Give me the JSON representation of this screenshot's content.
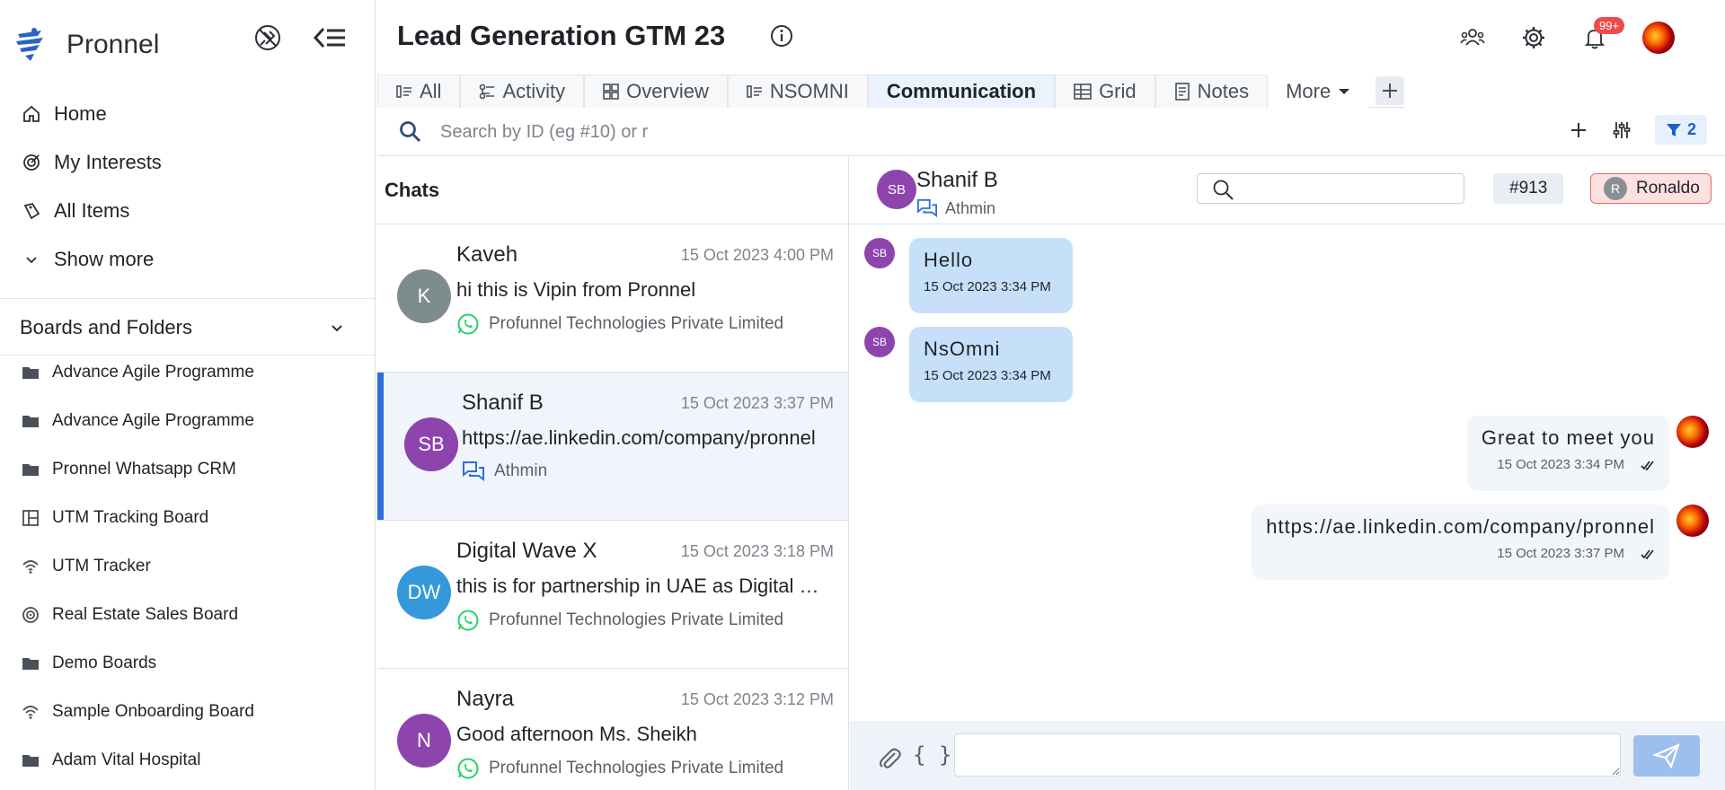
{
  "brand": {
    "name": "Pronnel"
  },
  "sidebar": {
    "nav": [
      {
        "label": "Home",
        "icon": "home-icon"
      },
      {
        "label": "My Interests",
        "icon": "target-icon"
      },
      {
        "label": "All Items",
        "icon": "tag-icon"
      },
      {
        "label": "Show more",
        "icon": "chevron-down-icon"
      }
    ],
    "boards_title": "Boards and Folders",
    "folders": [
      {
        "label": "Advance Agile Programme",
        "icon": "folder-icon"
      },
      {
        "label": "Advance Agile Programme",
        "icon": "folder-icon"
      },
      {
        "label": "Pronnel Whatsapp CRM",
        "icon": "folder-icon"
      },
      {
        "label": "UTM Tracking Board",
        "icon": "board-icon"
      },
      {
        "label": "UTM Tracker",
        "icon": "wifi-icon"
      },
      {
        "label": "Real Estate Sales Board",
        "icon": "target-icon"
      },
      {
        "label": "Demo Boards",
        "icon": "folder-icon"
      },
      {
        "label": "Sample Onboarding Board",
        "icon": "wifi-icon"
      },
      {
        "label": "Adam Vital Hospital",
        "icon": "folder-icon"
      }
    ]
  },
  "header": {
    "title": "Lead Generation GTM 23",
    "notification_count": "99+"
  },
  "tabs": [
    {
      "label": "All",
      "icon": "list-icon"
    },
    {
      "label": "Activity",
      "icon": "activity-icon"
    },
    {
      "label": "Overview",
      "icon": "grid-icon"
    },
    {
      "label": "NSOMNI",
      "icon": "list-icon"
    },
    {
      "label": "Communication",
      "icon": "",
      "active": true
    },
    {
      "label": "Grid",
      "icon": "table-icon"
    },
    {
      "label": "Notes",
      "icon": "notes-icon"
    },
    {
      "label": "More",
      "icon": "caret-down-icon"
    }
  ],
  "search": {
    "placeholder": "Search by ID (eg #10) or r",
    "value": ""
  },
  "filter": {
    "count": "2"
  },
  "chats": {
    "title": "Chats",
    "items": [
      {
        "initials": "K",
        "name": "Kaveh",
        "time": "15 Oct 2023 4:00 PM",
        "preview": "hi this is Vipin from Pronnel",
        "source": "Profunnel Technologies Private Limited",
        "channel": "whatsapp",
        "color": "#7f8c8d"
      },
      {
        "initials": "SB",
        "name": "Shanif B",
        "time": "15 Oct 2023 3:37 PM",
        "preview": "https://ae.linkedin.com/company/pronnel",
        "source": "Athmin",
        "channel": "chat",
        "color": "#8e44ad",
        "selected": true
      },
      {
        "initials": "DW",
        "name": "Digital Wave X",
        "time": "15 Oct 2023 3:18 PM",
        "preview": "this is for partnership in UAE as Digital Marketing",
        "source": "Profunnel Technologies Private Limited",
        "channel": "whatsapp",
        "color": "#3498db"
      },
      {
        "initials": "N",
        "name": "Nayra",
        "time": "15 Oct 2023 3:12 PM",
        "preview": "Good afternoon Ms. Sheikh",
        "source": "Profunnel Technologies Private Limited",
        "channel": "whatsapp",
        "color": "#8e44ad"
      }
    ]
  },
  "conversation": {
    "initials": "SB",
    "name": "Shanif B",
    "source": "Athmin",
    "id": "#913",
    "assignee": {
      "initial": "R",
      "name": "Ronaldo"
    },
    "messages": [
      {
        "dir": "in",
        "initials": "SB",
        "text": "Hello",
        "time": "15 Oct 2023 3:34 PM"
      },
      {
        "dir": "in",
        "initials": "SB",
        "text": "NsOmni",
        "time": "15 Oct 2023 3:34 PM"
      },
      {
        "dir": "out",
        "text": "Great to meet you",
        "time": "15 Oct 2023 3:34 PM"
      },
      {
        "dir": "out",
        "text": "https://ae.linkedin.com/company/pronnel",
        "time": "15 Oct 2023 3:37 PM"
      }
    ],
    "composer": {
      "braces": "{ }"
    }
  },
  "colors": {
    "accent": "#2f6fdc",
    "in_bubble": "#c7e0fa",
    "out_bubble": "#f2f5f9",
    "whatsapp": "#25d366",
    "badge": "#f04b4b"
  }
}
